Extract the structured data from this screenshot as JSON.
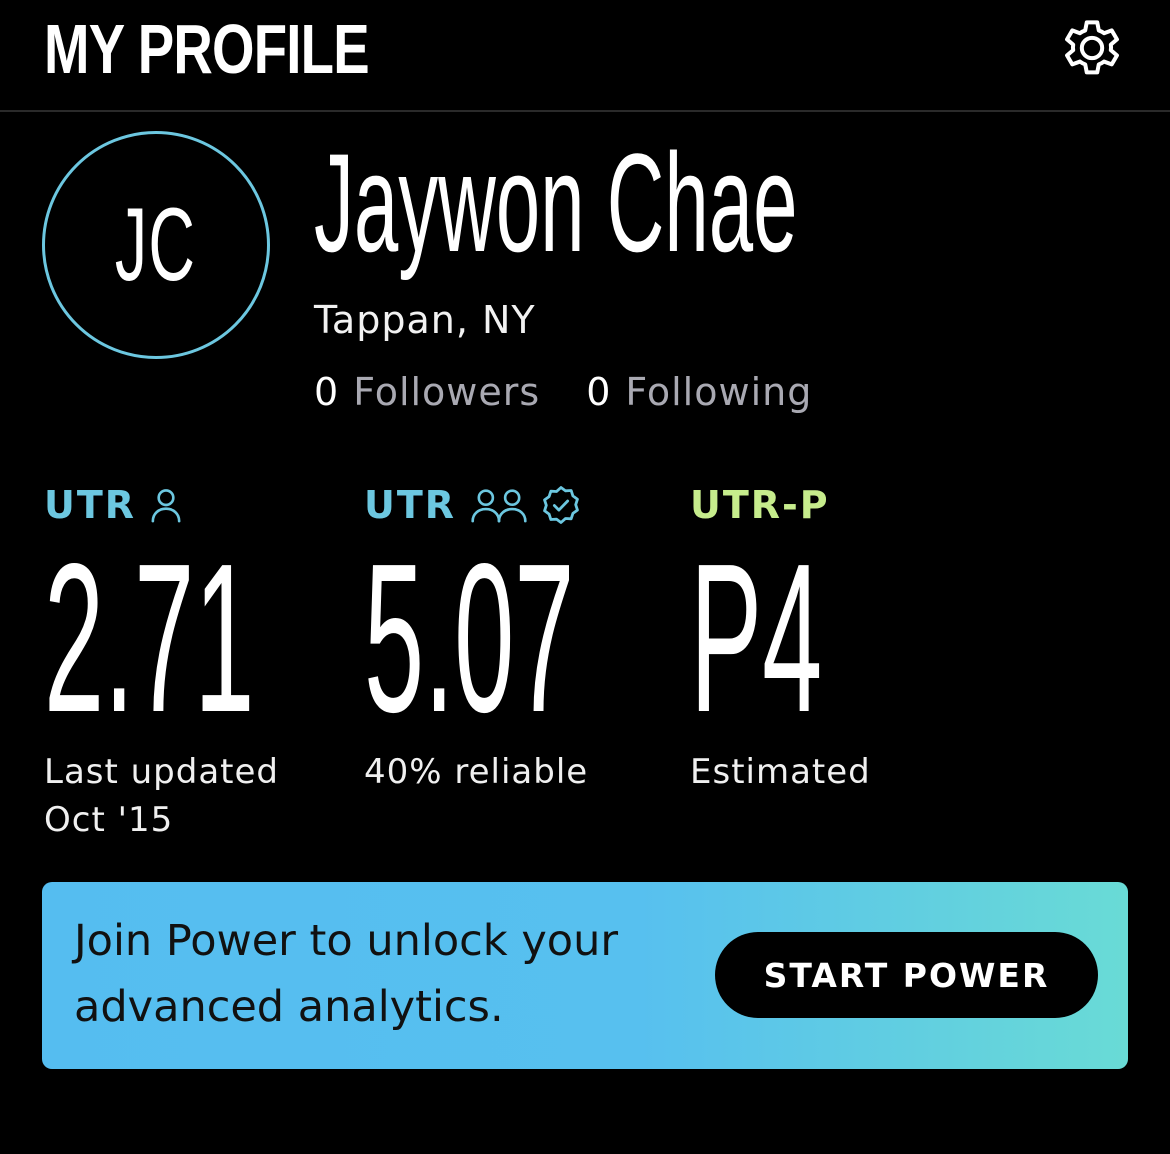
{
  "header": {
    "title": "MY PROFILE",
    "settings_icon": "gear-icon"
  },
  "profile": {
    "initials": "JC",
    "name": "Jaywon Chae",
    "location": "Tappan, NY",
    "followers_count": "0",
    "followers_label": "Followers",
    "following_count": "0",
    "following_label": "Following"
  },
  "stats": [
    {
      "label": "UTR",
      "icons": [
        "single-person-icon"
      ],
      "value": "2.71",
      "caption_line1": "Last updated",
      "caption_line2": "Oct '15",
      "label_color": "#6cc7e0"
    },
    {
      "label": "UTR",
      "icons": [
        "two-people-icon",
        "verified-badge-icon"
      ],
      "value": "5.07",
      "caption_line1": "40% reliable",
      "label_color": "#6cc7e0"
    },
    {
      "label": "UTR-P",
      "icons": [],
      "value": "P4",
      "caption_line1": "Estimated",
      "label_color": "#c6ec8c"
    }
  ],
  "promo": {
    "text": "Join Power to unlock your advanced analytics.",
    "button_label": "START POWER"
  },
  "colors": {
    "background": "#000000",
    "accent_blue": "#6cc7e0",
    "accent_green": "#c6ec8c",
    "promo_gradient_start": "#55bdf0",
    "promo_gradient_end": "#69dbd6"
  }
}
